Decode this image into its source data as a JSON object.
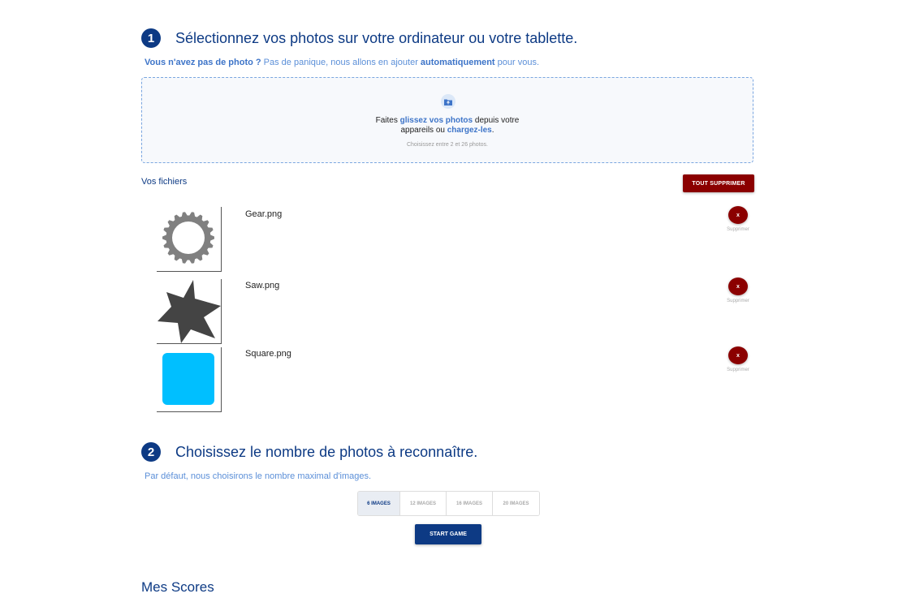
{
  "step1": {
    "number": "1",
    "title": "Sélectionnez vos photos sur votre ordinateur ou votre tablette.",
    "hint_q": "Vous n'avez pas de photo ?",
    "hint_mid": " Pas de panique, nous allons en ajouter ",
    "hint_bold": "automatiquement",
    "hint_end": " pour vous."
  },
  "dropzone": {
    "icon": "folder-upload-icon",
    "text_a": "Faites ",
    "text_link1": "glissez vos photos",
    "text_b": " depuis votre",
    "text_c": "appareils ou ",
    "text_link2": "chargez-les",
    "text_d": ".",
    "sub": "Choisissez entre 2 et 26 photos."
  },
  "files": {
    "label": "Vos fichiers",
    "delete_all": "TOUT SUPPRIMER",
    "remove_label": "x",
    "remove_caption": "Supprimer",
    "items": [
      {
        "name": "Gear.png",
        "shape": "gear",
        "color": "#808080"
      },
      {
        "name": "Saw.png",
        "shape": "saw",
        "color": "#444444"
      },
      {
        "name": "Square.png",
        "shape": "square",
        "color": "#00bfff"
      }
    ]
  },
  "step2": {
    "number": "2",
    "title": "Choisissez le nombre de photos à reconnaître.",
    "hint": "Par défaut, nous choisirons le nombre maximal d'images."
  },
  "options": {
    "items": [
      "6 IMAGES",
      "12 IMAGES",
      "16 IMAGES",
      "20 IMAGES"
    ],
    "selected": "6 IMAGES"
  },
  "start_label": "START GAME",
  "scores_title": "Mes Scores",
  "colors": {
    "primary": "#0d3a84",
    "danger": "#8b0000",
    "link": "#3d74c8"
  }
}
